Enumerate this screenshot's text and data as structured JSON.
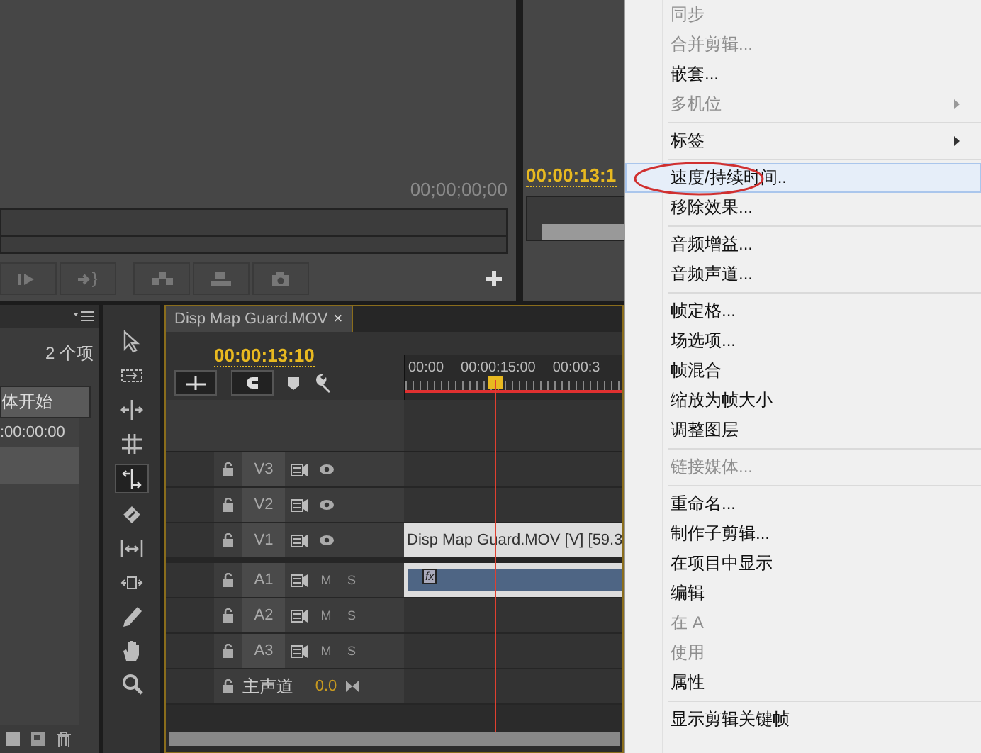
{
  "source_monitor": {
    "timecode": "00;00;00;00"
  },
  "program_monitor": {
    "timecode": "00:00:13:1"
  },
  "project_panel": {
    "item_count": "2 个项",
    "column_header": "体开始",
    "cell": ":00:00:00"
  },
  "tools": [
    {
      "kind": "arrow",
      "selected": false
    },
    {
      "kind": "track",
      "selected": false
    },
    {
      "kind": "ripple",
      "selected": false
    },
    {
      "kind": "rolling",
      "selected": false
    },
    {
      "kind": "rate",
      "selected": true
    },
    {
      "kind": "razor",
      "selected": false
    },
    {
      "kind": "slip",
      "selected": false
    },
    {
      "kind": "slide",
      "selected": false
    },
    {
      "kind": "pen",
      "selected": false
    },
    {
      "kind": "hand",
      "selected": false
    },
    {
      "kind": "zoom",
      "selected": false
    }
  ],
  "timeline": {
    "tab_title": "Disp Map Guard.MOV",
    "tab_close": "×",
    "timecode": "00:00:13:10",
    "ruler_labels": [
      "00:00",
      "00:00:15:00",
      "00:00:3"
    ],
    "tracks": [
      {
        "kind": "video",
        "label": "V3"
      },
      {
        "kind": "video",
        "label": "V2"
      },
      {
        "kind": "video",
        "label": "V1",
        "clip": "Disp Map Guard.MOV [V] [59.3"
      },
      {
        "kind": "audio",
        "label": "A1",
        "mute": "M",
        "solo": "S",
        "clip_badge": "fx"
      },
      {
        "kind": "audio",
        "label": "A2",
        "mute": "M",
        "solo": "S"
      },
      {
        "kind": "audio",
        "label": "A3",
        "mute": "M",
        "solo": "S"
      },
      {
        "kind": "master",
        "label": "主声道",
        "value": "0.0"
      }
    ]
  },
  "context_menu": [
    {
      "kind": "item",
      "label": "同步",
      "disabled": true,
      "submenu": false,
      "selected": false
    },
    {
      "kind": "item",
      "label": "合并剪辑...",
      "disabled": true,
      "submenu": false,
      "selected": false
    },
    {
      "kind": "item",
      "label": "嵌套...",
      "disabled": false,
      "submenu": false,
      "selected": false
    },
    {
      "kind": "item",
      "label": "多机位",
      "disabled": true,
      "submenu": true,
      "selected": false
    },
    {
      "kind": "separator"
    },
    {
      "kind": "item",
      "label": "标签",
      "disabled": false,
      "submenu": true,
      "selected": false
    },
    {
      "kind": "separator"
    },
    {
      "kind": "item",
      "label": "速度/持续时间..",
      "disabled": false,
      "submenu": false,
      "selected": true
    },
    {
      "kind": "item",
      "label": "移除效果...",
      "disabled": false,
      "submenu": false,
      "selected": false
    },
    {
      "kind": "separator"
    },
    {
      "kind": "item",
      "label": "音频增益...",
      "disabled": false,
      "submenu": false,
      "selected": false
    },
    {
      "kind": "item",
      "label": "音频声道...",
      "disabled": false,
      "submenu": false,
      "selected": false
    },
    {
      "kind": "separator"
    },
    {
      "kind": "item",
      "label": "帧定格...",
      "disabled": false,
      "submenu": false,
      "selected": false
    },
    {
      "kind": "item",
      "label": "场选项...",
      "disabled": false,
      "submenu": false,
      "selected": false
    },
    {
      "kind": "item",
      "label": "帧混合",
      "disabled": false,
      "submenu": false,
      "selected": false
    },
    {
      "kind": "item",
      "label": "缩放为帧大小",
      "disabled": false,
      "submenu": false,
      "selected": false
    },
    {
      "kind": "item",
      "label": "调整图层",
      "disabled": false,
      "submenu": false,
      "selected": false
    },
    {
      "kind": "separator"
    },
    {
      "kind": "item",
      "label": "链接媒体...",
      "disabled": true,
      "submenu": false,
      "selected": false
    },
    {
      "kind": "separator"
    },
    {
      "kind": "item",
      "label": "重命名...",
      "disabled": false,
      "submenu": false,
      "selected": false
    },
    {
      "kind": "item",
      "label": "制作子剪辑...",
      "disabled": false,
      "submenu": false,
      "selected": false
    },
    {
      "kind": "item",
      "label": "在项目中显示",
      "disabled": false,
      "submenu": false,
      "selected": false
    },
    {
      "kind": "item",
      "label": "编辑",
      "disabled": false,
      "submenu": false,
      "selected": false
    },
    {
      "kind": "item",
      "label": "在 A",
      "disabled": true,
      "submenu": false,
      "selected": false
    },
    {
      "kind": "item",
      "label": "使用",
      "disabled": true,
      "submenu": false,
      "selected": false
    },
    {
      "kind": "item",
      "label": "属性",
      "disabled": false,
      "submenu": false,
      "selected": false
    },
    {
      "kind": "separator"
    },
    {
      "kind": "item",
      "label": "显示剪辑关键帧",
      "disabled": false,
      "submenu": false,
      "selected": false
    }
  ]
}
